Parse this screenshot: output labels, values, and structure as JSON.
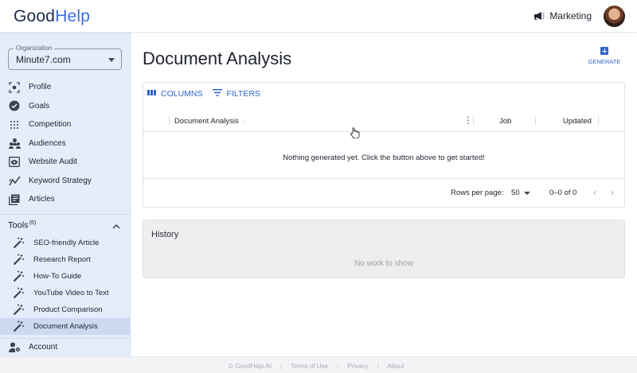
{
  "header": {
    "logo_good": "Good",
    "logo_help": "Help",
    "workspace_label": "Marketing"
  },
  "sidebar": {
    "org_label": "Organization",
    "org_value": "Minute7.com",
    "items": [
      {
        "label": "Profile",
        "icon": "profile-icon"
      },
      {
        "label": "Goals",
        "icon": "check-circle-icon"
      },
      {
        "label": "Competition",
        "icon": "grid-dots-icon"
      },
      {
        "label": "Audiences",
        "icon": "audiences-icon"
      },
      {
        "label": "Website Audit",
        "icon": "eye-icon"
      },
      {
        "label": "Keyword Strategy",
        "icon": "trend-icon"
      },
      {
        "label": "Articles",
        "icon": "articles-icon"
      }
    ],
    "tools_label": "Tools",
    "tools_count": "(6)",
    "tools": [
      {
        "label": "SEO-friendly Article",
        "icon": "magic-wand-icon"
      },
      {
        "label": "Research Report",
        "icon": "magic-wand-icon"
      },
      {
        "label": "How-To Guide",
        "icon": "magic-wand-icon"
      },
      {
        "label": "YouTube Video to Text",
        "icon": "magic-wand-icon"
      },
      {
        "label": "Product Comparison",
        "icon": "magic-wand-icon"
      },
      {
        "label": "Document Analysis",
        "icon": "magic-wand-icon",
        "active": true
      }
    ],
    "account_label": "Account"
  },
  "main": {
    "title": "Document Analysis",
    "generate_label": "GENERATE",
    "toolbar": {
      "columns_label": "COLUMNS",
      "filters_label": "FILTERS"
    },
    "columns": {
      "document": "Document Analysis",
      "job": "Job",
      "updated": "Updated"
    },
    "empty_message": "Nothing generated yet. Click the button above to get started!",
    "pagination": {
      "rows_per_page_label": "Rows per page:",
      "rows_per_page": "50",
      "range": "0–0 of 0"
    },
    "history": {
      "title": "History",
      "empty": "No work to show"
    }
  },
  "footer": {
    "copyright": "© GoodHelp.AI",
    "links": [
      "Terms of Use",
      "Privacy",
      "About"
    ]
  },
  "colors": {
    "accent": "#2f63c9",
    "sidebar_bg": "#e5ecfa",
    "active_bg": "#cdd9f1"
  }
}
